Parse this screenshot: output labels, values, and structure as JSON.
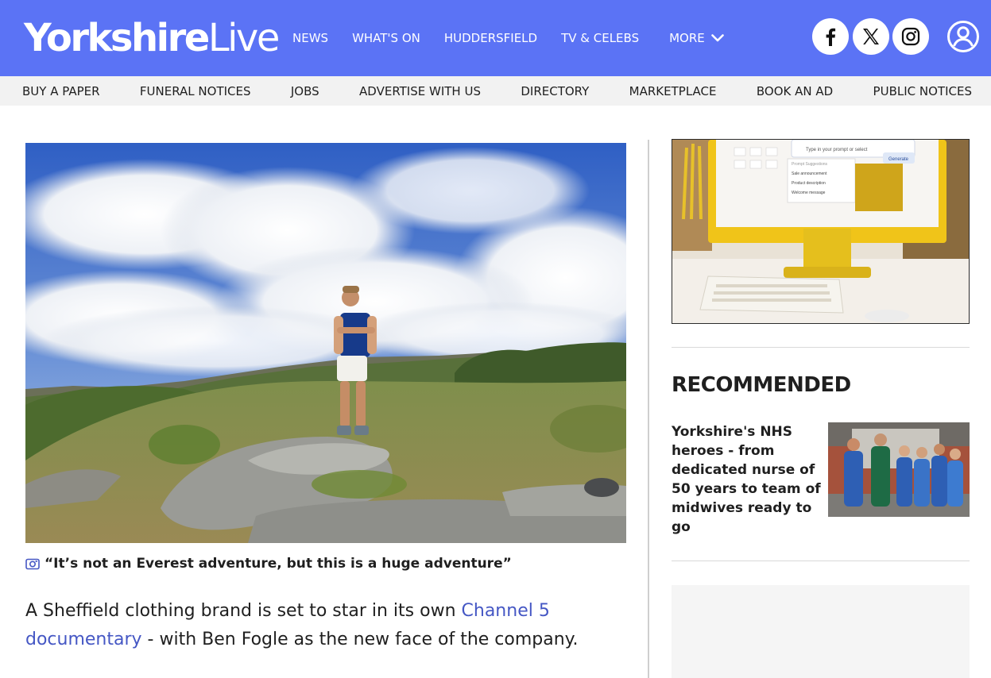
{
  "header": {
    "logo_bold": "Yorkshire",
    "logo_light": "Live",
    "nav": [
      "NEWS",
      "WHAT'S ON",
      "HUDDERSFIELD",
      "TV & CELEBS"
    ],
    "more_label": "MORE",
    "colors": {
      "brand": "#5b73f5",
      "link": "#4557c4"
    },
    "social_icons": [
      "facebook-icon",
      "x-icon",
      "instagram-icon"
    ],
    "account_icon": "user-account-icon"
  },
  "subnav": [
    "BUY A PAPER",
    "FUNERAL NOTICES",
    "JOBS",
    "ADVERTISE WITH US",
    "DIRECTORY",
    "MARKETPLACE",
    "BOOK AN AD",
    "PUBLIC NOTICES"
  ],
  "article": {
    "caption_icon": "camera-icon",
    "caption": "“It’s not an Everest adventure, but this is a huge adventure”",
    "lede_before": "A Sheffield clothing brand is set to star in its own ",
    "lede_link": "Channel 5 documentary",
    "lede_after": " - with Ben Fogle as the new face of the company."
  },
  "sidebar": {
    "ad_prompt_text": "Type in your prompt or select",
    "ad_generate_label": "Generate",
    "ad_suggestions": [
      "Prompt Suggestions",
      "Sale announcement",
      "Product description",
      "Welcome message"
    ],
    "recommended_heading": "RECOMMENDED",
    "recommended_items": [
      {
        "title": "Yorkshire's NHS heroes - from dedicated nurse of 50 years to team of midwives ready to go"
      }
    ]
  }
}
